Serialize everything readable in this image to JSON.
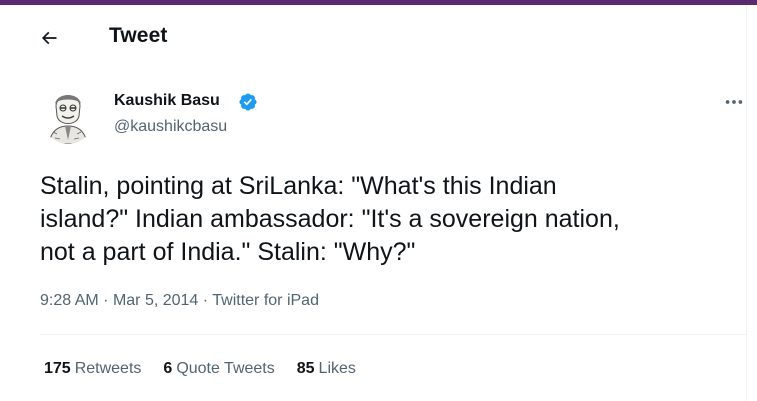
{
  "header": {
    "title": "Tweet",
    "back_icon": "arrow-left-icon"
  },
  "author": {
    "display_name": "Kaushik Basu",
    "handle": "@kaushikcbasu",
    "verified": true,
    "verified_color": "#1d9bf0"
  },
  "tweet": {
    "text": "Stalin, pointing at SriLanka: \"What's this Indian\nisland?\" Indian ambassador: \"It's a sovereign nation,\nnot a part of India.\" Stalin: \"Why?\"",
    "time": "9:28 AM",
    "date": "Mar 5, 2014",
    "source": "Twitter for iPad",
    "separator": "·"
  },
  "stats": [
    {
      "count": "175",
      "label": "Retweets"
    },
    {
      "count": "6",
      "label": "Quote Tweets"
    },
    {
      "count": "85",
      "label": "Likes"
    }
  ],
  "colors": {
    "accent_bar": "#5a2a6e",
    "text": "#0f1419",
    "secondary": "#536471"
  }
}
